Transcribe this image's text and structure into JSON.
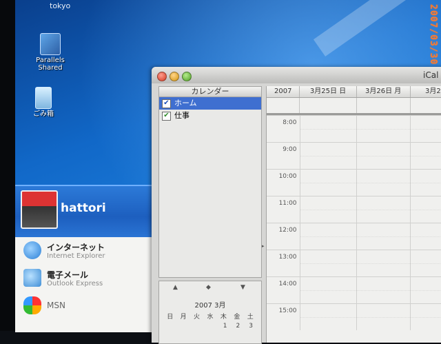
{
  "desktop": {
    "top_label": "tokyo",
    "icons": [
      {
        "name": "parallels-shared",
        "label_1": "Parallels",
        "label_2": "Shared"
      },
      {
        "name": "recycle-bin",
        "label_1": "ごみ箱",
        "label_2": ""
      }
    ]
  },
  "start_menu": {
    "username": "hattori",
    "items": [
      {
        "title": "インターネット",
        "subtitle": "Internet Explorer",
        "icon": "internet-explorer-icon"
      },
      {
        "title": "電子メール",
        "subtitle": "Outlook Express",
        "icon": "mail-icon"
      },
      {
        "title": "MSN",
        "subtitle": "",
        "icon": "msn-icon"
      }
    ]
  },
  "ical": {
    "title": "iCal",
    "calendars_header": "カレンダー",
    "calendars": [
      {
        "name": "ホーム",
        "checked": "✔",
        "selected": true
      },
      {
        "name": "仕事",
        "checked": "✔",
        "selected": false
      }
    ],
    "mini_calendar": {
      "title": "2007 3月",
      "weekdays": [
        "日",
        "月",
        "火",
        "水",
        "木",
        "金",
        "土"
      ],
      "first_dates": [
        "1",
        "2",
        "3"
      ],
      "nav_prev": "▲",
      "nav_today": "◆",
      "nav_next": "▼"
    },
    "week_header": {
      "year": "2007",
      "days": [
        "3月25日 日",
        "3月26日 月",
        "3月2"
      ]
    },
    "hours": [
      "8:00",
      "9:00",
      "10:00",
      "11:00",
      "12:00",
      "13:00",
      "14:00",
      "15:00"
    ]
  },
  "photo_datestamp": "2007/03/30"
}
